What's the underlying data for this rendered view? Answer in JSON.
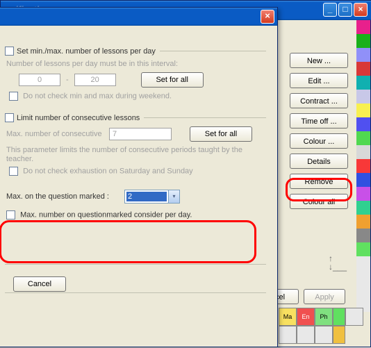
{
  "bgWindow": {
    "title": "…ification"
  },
  "rightPanel": {
    "new": "New ...",
    "edit": "Edit ...",
    "contract": "Contract ...",
    "timeOff": "Time off ...",
    "colour": "Colour ...",
    "details": "Details",
    "remove": "Remove",
    "colourAll": "Colour all"
  },
  "bottom": {
    "ncel": "ncel",
    "apply": "Apply"
  },
  "dialog": {
    "section1": {
      "check": "Set min./max. number of lessons per day",
      "hint": "Number of lessons per day must be in this interval:",
      "min": "0",
      "max": "20",
      "setAll": "Set for all",
      "noWeekend": "Do not check min and max during weekend."
    },
    "section2": {
      "check": "Limit number of consecutive lessons",
      "maxLabel": "Max. number of consecutive",
      "maxVal": "7",
      "setAll": "Set for all",
      "desc": "This parameter limits the number of consecutive periods taught by the teacher.",
      "noSatSun": "Do not check exhaustion on Saturday and Sunday"
    },
    "section3": {
      "maxQLabel": "Max. on the question marked :",
      "maxQVal": "2",
      "perDay": "Max. number on questionmarked consider per day."
    },
    "cancel": "Cancel"
  },
  "gridCells": {
    "ma": "Ma",
    "en": "En",
    "ph": "Ph"
  }
}
